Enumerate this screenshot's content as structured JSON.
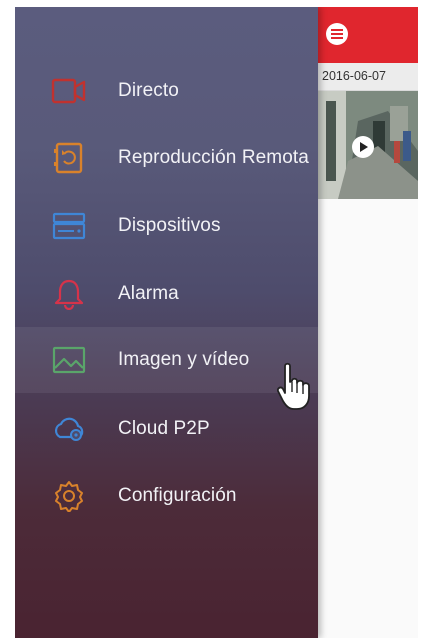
{
  "drawer": {
    "items": [
      {
        "label": "Directo",
        "icon": "live-camera-icon",
        "color": "#c0322f"
      },
      {
        "label": "Reproducción Remota",
        "icon": "remote-playback-icon",
        "color": "#d9822b"
      },
      {
        "label": "Dispositivos",
        "icon": "devices-icon",
        "color": "#3f86d6"
      },
      {
        "label": "Alarma",
        "icon": "bell-icon",
        "color": "#d6334a"
      },
      {
        "label": "Imagen y vídeo",
        "icon": "image-icon",
        "color": "#5aa56a",
        "active": true
      },
      {
        "label": "Cloud P2P",
        "icon": "cloud-icon",
        "color": "#3f86d6"
      },
      {
        "label": "Configuración",
        "icon": "gear-icon",
        "color": "#d9822b"
      }
    ]
  },
  "header": {
    "menu_icon": "menu-icon",
    "color": "#e0262e"
  },
  "gallery": {
    "date": "2016-06-07",
    "thumbnail_icon": "play-icon"
  }
}
